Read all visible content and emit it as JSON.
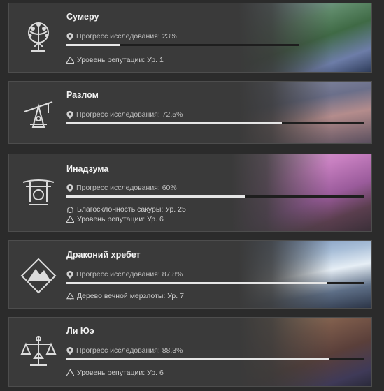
{
  "regions": [
    {
      "name": "Сумеру",
      "progress_label": "Прогресс исследования: 23%",
      "progress": 0.23,
      "emblem": "sumeru-tree-emblem-icon",
      "stats": [
        {
          "icon": "reputation-icon",
          "text": "Уровень репутации: Ур. 1"
        }
      ]
    },
    {
      "name": "Разлом",
      "progress_label": "Прогресс исследования: 72.5%",
      "progress": 0.725,
      "emblem": "chasm-crane-emblem-icon",
      "stats": []
    },
    {
      "name": "Инадзума",
      "progress_label": "Прогресс исследования: 60%",
      "progress": 0.6,
      "emblem": "inazuma-torii-emblem-icon",
      "stats": [
        {
          "icon": "sakura-icon",
          "text": "Благосклонность сакуры: Ур. 25"
        },
        {
          "icon": "reputation-icon",
          "text": "Уровень репутации: Ур. 6"
        }
      ]
    },
    {
      "name": "Драконий хребет",
      "progress_label": "Прогресс исследования: 87.8%",
      "progress": 0.878,
      "emblem": "dragonspine-mountain-emblem-icon",
      "stats": [
        {
          "icon": "frostbearing-tree-icon",
          "text": "Дерево вечной мерзлоты: Ур. 7"
        }
      ]
    },
    {
      "name": "Ли Юэ",
      "progress_label": "Прогресс исследования: 88.3%",
      "progress": 0.883,
      "emblem": "liyue-scales-emblem-icon",
      "stats": [
        {
          "icon": "reputation-icon",
          "text": "Уровень репутации: Ур. 6"
        }
      ]
    }
  ],
  "colors": {
    "card_bg": "#3a3a3a",
    "bar_fill": "#e6e6e6",
    "bar_track": "#1e1e1e"
  }
}
